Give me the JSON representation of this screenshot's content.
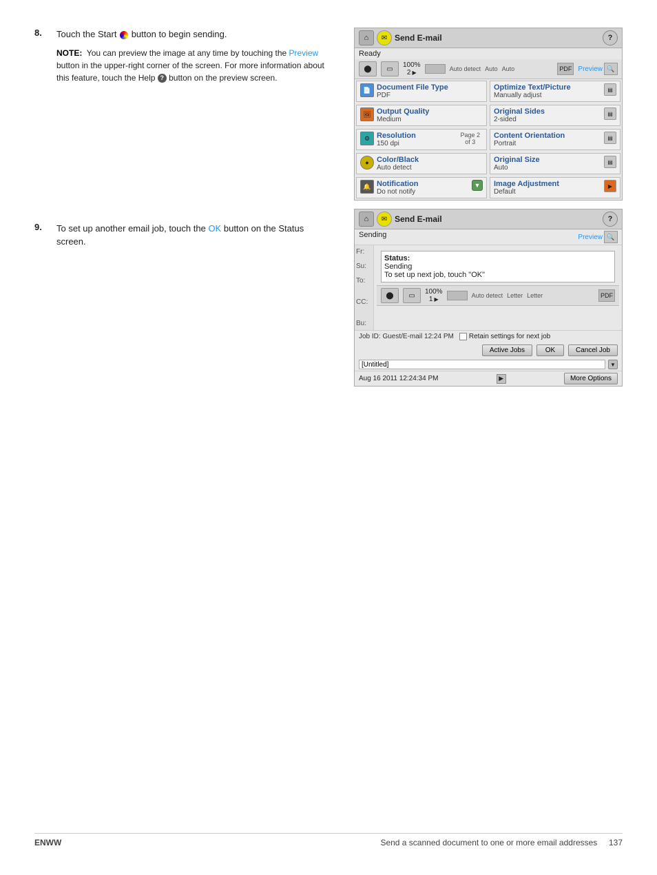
{
  "steps": [
    {
      "number": "8.",
      "text": "Touch the Start",
      "text_after_icon": "button to begin sending.",
      "note_label": "NOTE:",
      "note_text": "You can preview the image at any time by touching the",
      "note_link": "Preview",
      "note_text2": "button in the upper-right corner of the screen. For more information about this feature, touch the Help",
      "note_text3": "button on the preview screen."
    },
    {
      "number": "9.",
      "text": "To set up another email job, touch the",
      "text_link": "OK",
      "text_after": "button on the Status screen."
    }
  ],
  "panel1": {
    "title": "Send E-mail",
    "status": "Ready",
    "toolbar": {
      "percent": "100%",
      "page_val": "2",
      "arrow": "▶",
      "auto_label": "Auto detect",
      "auto1": "Auto",
      "auto2": "Auto",
      "pdf_label": "PDF",
      "preview_label": "Preview"
    },
    "grid": [
      {
        "left": {
          "icon_color": "blue",
          "title": "Document File Type",
          "value": "PDF"
        },
        "right": {
          "title": "Optimize Text/Picture",
          "value": "Manually adjust"
        }
      },
      {
        "left": {
          "icon_color": "orange",
          "title": "Output Quality",
          "value": "Medium"
        },
        "right": {
          "title": "Original Sides",
          "value": "2-sided"
        }
      },
      {
        "left": {
          "icon_color": "teal",
          "title": "Resolution",
          "value": "150 dpi",
          "page_indicator": "Page 2\nof 3"
        },
        "right": {
          "title": "Content Orientation",
          "value": "Portrait"
        }
      },
      {
        "left": {
          "icon_color": "yellow",
          "title": "Color/Black",
          "value": "Auto detect"
        },
        "right": {
          "title": "Original Size",
          "value": "Auto"
        }
      },
      {
        "left": {
          "icon_color": "dark",
          "title": "Notification",
          "value": "Do not notify"
        },
        "right": {
          "title": "Image Adjustment",
          "value": "Default",
          "has_dropdown": true
        }
      }
    ]
  },
  "panel2": {
    "title": "Send E-mail",
    "status": "Sending",
    "preview_label": "Preview",
    "status_box": {
      "status_label": "Status:",
      "status_value": "Sending",
      "instruction": "To set up next job, touch \"OK\""
    },
    "toolbar": {
      "percent": "100%",
      "page_val": "1",
      "arrow": "▶",
      "auto_label": "Auto detect",
      "letter1": "Letter",
      "letter2": "Letter",
      "pdf_label": "PDF"
    },
    "fields": [
      {
        "label": "Fr:",
        "value": ""
      },
      {
        "label": "Su:",
        "value": ""
      },
      {
        "label": "To:",
        "value": ""
      },
      {
        "label": "CC:",
        "value": ""
      },
      {
        "label": "Bu:",
        "value": ""
      }
    ],
    "job_id": "Job ID: Guest/E-mail 12:24 PM",
    "retain_label": "Retain settings for next job",
    "buttons": {
      "active_jobs": "Active Jobs",
      "ok": "OK",
      "cancel_job": "Cancel Job"
    },
    "file_name": "[Untitled]",
    "timestamp": "Aug 16 2011 12:24:34 PM",
    "more_options": "More Options"
  },
  "footer": {
    "left": "ENWW",
    "right_text": "Send a scanned document to one or more email addresses",
    "page": "137"
  }
}
